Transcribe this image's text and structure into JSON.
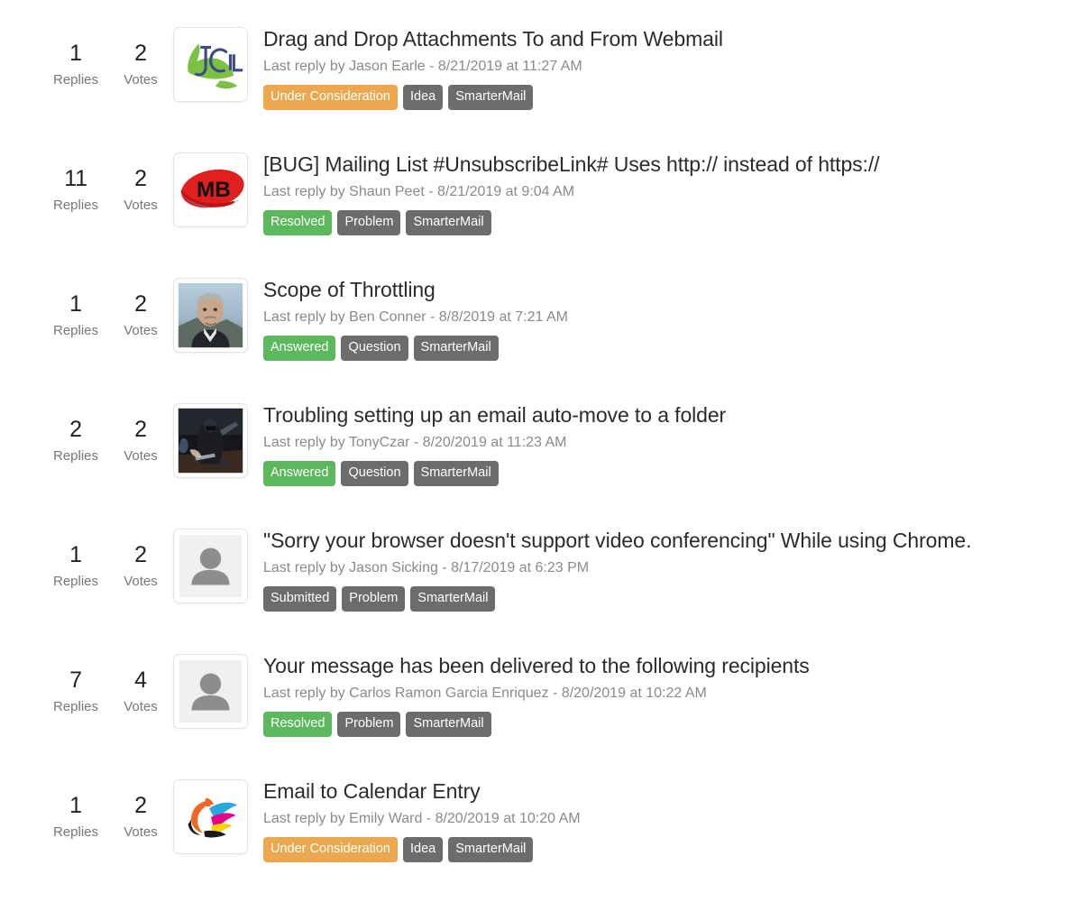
{
  "labels": {
    "replies": "Replies",
    "votes": "Votes"
  },
  "colors": {
    "status_orange": "#eca84f",
    "status_green": "#5cb85c",
    "status_gray": "#6c6c6c",
    "title_text": "#2b2b2b",
    "meta_text": "#8a8a8a",
    "page_background": "#ffffff"
  },
  "threads": [
    {
      "replies": "1",
      "votes": "2",
      "avatar": "jcl-logo-avatar",
      "title": "Drag and Drop Attachments To and From Webmail",
      "meta": "Last reply by Jason Earle - 8/21/2019 at 11:27 AM",
      "tags": [
        {
          "label": "Under Consideration",
          "color": "orange"
        },
        {
          "label": "Idea",
          "color": "gray"
        },
        {
          "label": "SmarterMail",
          "color": "gray"
        }
      ]
    },
    {
      "replies": "11",
      "votes": "2",
      "avatar": "mb-logo-avatar",
      "title": "[BUG] Mailing List #UnsubscribeLink# Uses http:// instead of https://",
      "meta": "Last reply by Shaun Peet - 8/21/2019 at 9:04 AM",
      "tags": [
        {
          "label": "Resolved",
          "color": "green"
        },
        {
          "label": "Problem",
          "color": "gray"
        },
        {
          "label": "SmarterMail",
          "color": "gray"
        }
      ]
    },
    {
      "replies": "1",
      "votes": "2",
      "avatar": "man-photo-avatar",
      "title": "Scope of Throttling",
      "meta": "Last reply by Ben Conner - 8/8/2019 at 7:21 AM",
      "tags": [
        {
          "label": "Answered",
          "color": "green"
        },
        {
          "label": "Question",
          "color": "gray"
        },
        {
          "label": "SmarterMail",
          "color": "gray"
        }
      ]
    },
    {
      "replies": "2",
      "votes": "2",
      "avatar": "knight-photo-avatar",
      "title": "Troubling setting up an email auto-move to a folder",
      "meta": "Last reply by TonyCzar - 8/20/2019 at 11:23 AM",
      "tags": [
        {
          "label": "Answered",
          "color": "green"
        },
        {
          "label": "Question",
          "color": "gray"
        },
        {
          "label": "SmarterMail",
          "color": "gray"
        }
      ]
    },
    {
      "replies": "1",
      "votes": "2",
      "avatar": "default-person-avatar",
      "title": "\"Sorry your browser doesn't support video conferencing\" While using Chrome.",
      "meta": "Last reply by Jason Sicking - 8/17/2019 at 6:23 PM",
      "tags": [
        {
          "label": "Submitted",
          "color": "gray"
        },
        {
          "label": "Problem",
          "color": "gray"
        },
        {
          "label": "SmarterMail",
          "color": "gray"
        }
      ]
    },
    {
      "replies": "7",
      "votes": "4",
      "avatar": "default-person-avatar",
      "title": "Your message has been delivered to the following recipients",
      "meta": "Last reply by Carlos Ramon Garcia Enriquez - 8/20/2019 at 10:22 AM",
      "tags": [
        {
          "label": "Resolved",
          "color": "green"
        },
        {
          "label": "Problem",
          "color": "gray"
        },
        {
          "label": "SmarterMail",
          "color": "gray"
        }
      ]
    },
    {
      "replies": "1",
      "votes": "2",
      "avatar": "phoenix-logo-avatar",
      "title": "Email to Calendar Entry",
      "meta": "Last reply by Emily Ward - 8/20/2019 at 10:20 AM",
      "tags": [
        {
          "label": "Under Consideration",
          "color": "orange"
        },
        {
          "label": "Idea",
          "color": "gray"
        },
        {
          "label": "SmarterMail",
          "color": "gray"
        }
      ]
    }
  ]
}
